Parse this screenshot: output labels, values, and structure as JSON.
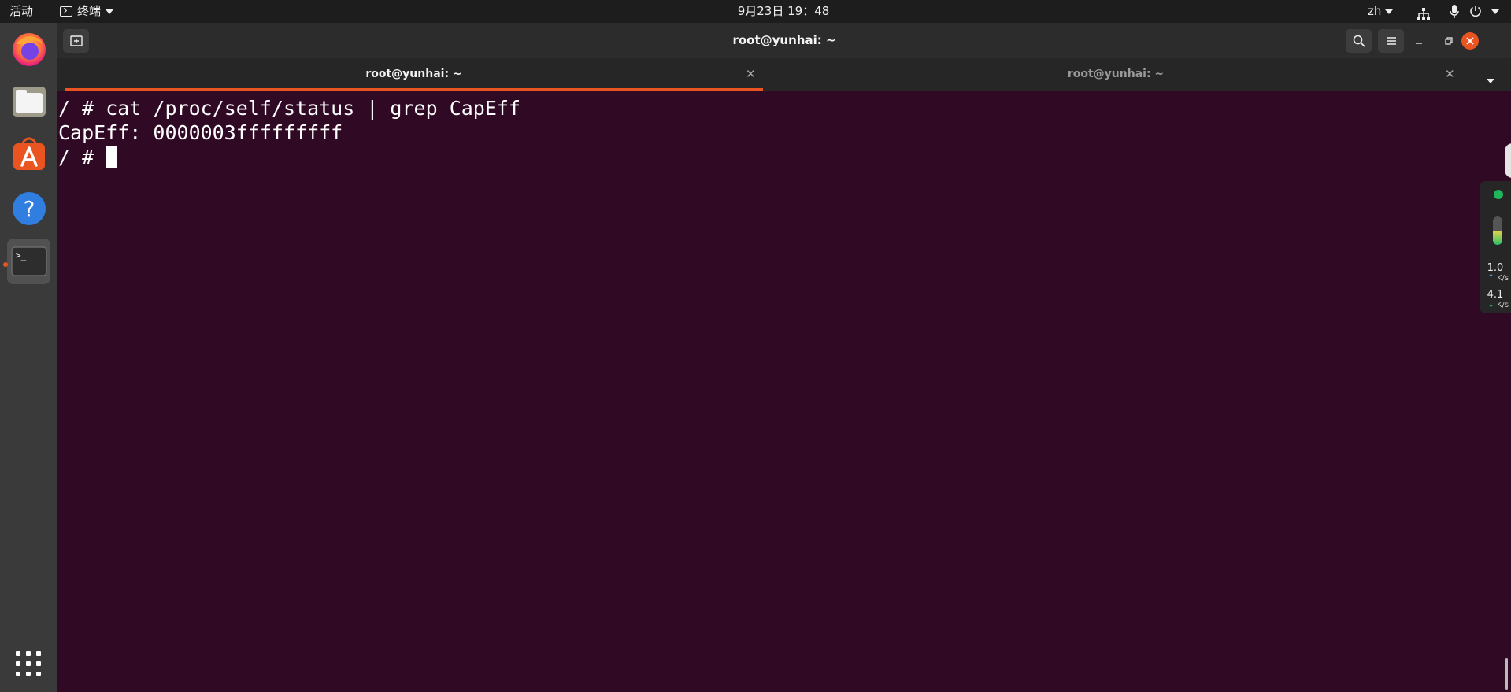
{
  "topbar": {
    "activities": "活动",
    "app_menu": "终端",
    "clock": "9月23日 19：48",
    "lang": "zh"
  },
  "dock": {
    "apps": [
      "firefox-icon",
      "files-icon",
      "software-center-icon",
      "help-icon",
      "terminal-icon"
    ],
    "active_app": "terminal"
  },
  "window": {
    "title": "root@yunhai: ~",
    "tabs": [
      {
        "label": "root@yunhai: ~",
        "active": true
      },
      {
        "label": "root@yunhai: ~",
        "active": false
      }
    ]
  },
  "terminal": {
    "lines": [
      "/ # cat /proc/self/status | grep CapEff",
      "CapEff: 0000003fffffffff"
    ],
    "prompt": "/ # "
  },
  "widget": {
    "upload_value": "1.0",
    "upload_unit": "K/s",
    "download_value": "4.1",
    "download_unit": "K/s",
    "status_color": "#1fb55a",
    "gauge_level": 0.5
  },
  "colors": {
    "terminal_bg": "#300a24",
    "accent": "#e95420"
  }
}
